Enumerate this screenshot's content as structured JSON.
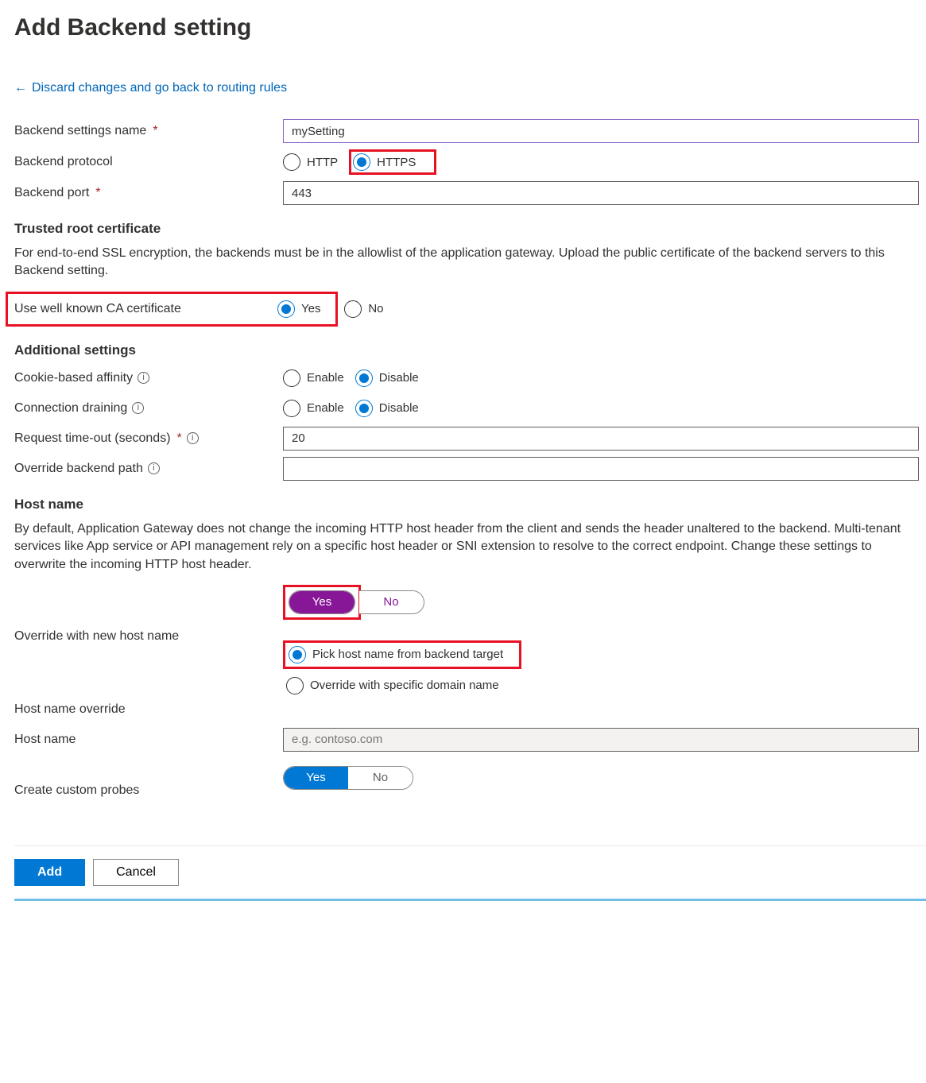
{
  "title": "Add Backend setting",
  "back_link": "Discard changes and go back to routing rules",
  "fields": {
    "name_label": "Backend settings name",
    "name_value": "mySetting",
    "protocol_label": "Backend protocol",
    "protocol_http": "HTTP",
    "protocol_https": "HTTPS",
    "port_label": "Backend port",
    "port_value": "443"
  },
  "trusted": {
    "heading": "Trusted root certificate",
    "desc": "For end-to-end SSL encryption, the backends must be in the allowlist of the application gateway. Upload the public certificate of the backend servers to this Backend setting.",
    "ca_label": "Use well known CA certificate",
    "yes": "Yes",
    "no": "No"
  },
  "additional": {
    "heading": "Additional settings",
    "cookie_label": "Cookie-based affinity",
    "drain_label": "Connection draining",
    "enable": "Enable",
    "disable": "Disable",
    "timeout_label": "Request time-out (seconds)",
    "timeout_value": "20",
    "override_path_label": "Override backend path",
    "override_path_value": ""
  },
  "host": {
    "heading": "Host name",
    "desc": "By default, Application Gateway does not change the incoming HTTP host header from the client and sends the header unaltered to the backend. Multi-tenant services like App service or API management rely on a specific host header or SNI extension to resolve to the correct endpoint. Change these settings to overwrite the incoming HTTP host header.",
    "yes": "Yes",
    "no": "No",
    "override_new_label": "Override with new host name",
    "pick_backend": "Pick host name from backend target",
    "override_specific": "Override with specific domain name",
    "hostname_override_label": "Host name override",
    "hostname_label": "Host name",
    "hostname_placeholder": "e.g. contoso.com",
    "probes_label": "Create custom probes"
  },
  "footer": {
    "add": "Add",
    "cancel": "Cancel"
  }
}
